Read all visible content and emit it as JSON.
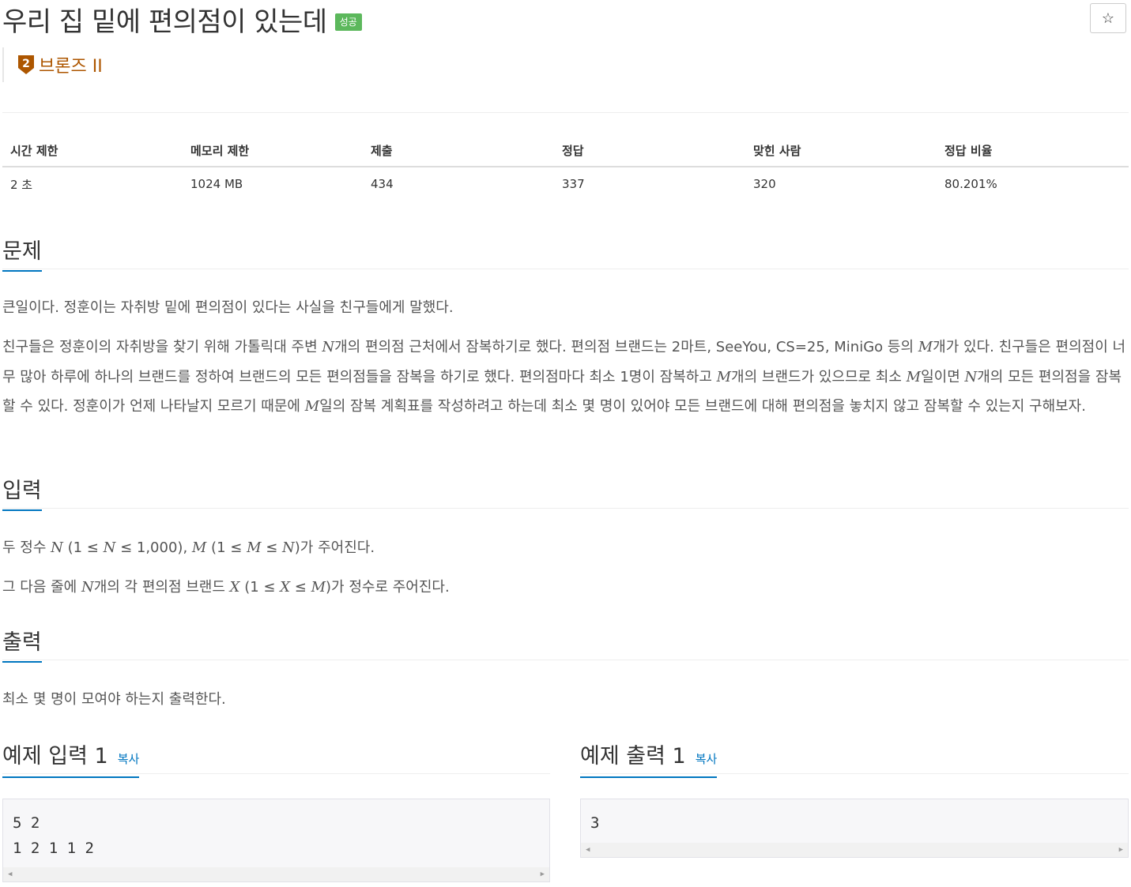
{
  "problem": {
    "title": "우리 집 밑에 편의점이 있는데",
    "status_badge": "성공",
    "tier": {
      "number": "2",
      "label": "브론즈 II",
      "color": "#ad5600"
    }
  },
  "stats": {
    "headers": [
      "시간 제한",
      "메모리 제한",
      "제출",
      "정답",
      "맞힌 사람",
      "정답 비율"
    ],
    "values": [
      "2 초",
      "1024 MB",
      "434",
      "337",
      "320",
      "80.201%"
    ]
  },
  "sections": {
    "problem": {
      "title": "문제",
      "p1": "큰일이다. 정훈이는 자취방 밑에 편의점이 있다는 사실을 친구들에게 말했다.",
      "p2": {
        "a": "친구들은 정훈이의 자취방을 찾기 위해 가톨릭대 주변 ",
        "N1": "N",
        "b": "개의 편의점 근처에서 잠복하기로 했다. 편의점 브랜드는 2마트, SeeYou, CS=25, MiniGo 등의 ",
        "M1": "M",
        "c": "개가 있다. 친구들은 편의점이 너무 많아 하루에 하나의 브랜드를 정하여 브랜드의 모든 편의점들을 잠복을 하기로 했다. 편의점마다 최소 1명이 잠복하고 ",
        "M2": "M",
        "d": "개의 브랜드가 있으므로 최소 ",
        "M3": "M",
        "e": "일이면 ",
        "N2": "N",
        "f": "개의 모든 편의점을 잠복할 수 있다. 정훈이가 언제 나타날지 모르기 때문에 ",
        "M4": "M",
        "g": "일의 잠복 계획표를 작성하려고 하는데 최소 몇 명이 있어야 모든 브랜드에 대해 편의점을 놓치지 않고 잠복할 수 있는지 구해보자."
      }
    },
    "input": {
      "title": "입력",
      "p1": {
        "a": "두 정수 ",
        "N1": "N",
        "b": " (1 ≤ ",
        "N2": "N",
        "c": " ≤ 1,000), ",
        "M1": "M",
        "d": " (1 ≤ ",
        "M2": "M",
        "e": " ≤ ",
        "N3": "N",
        "f": ")가 주어진다."
      },
      "p2": {
        "a": "그 다음 줄에 ",
        "N1": "N",
        "b": "개의 각 편의점 브랜드 ",
        "X1": "X",
        "c": " (1 ≤ ",
        "X2": "X",
        "d": " ≤ ",
        "M1": "M",
        "e": ")가 정수로 주어진다."
      }
    },
    "output": {
      "title": "출력",
      "p1": "최소 몇 명이 모여야 하는지 출력한다."
    }
  },
  "samples": {
    "input": {
      "title": "예제 입력 1",
      "copy": "복사",
      "lines": "5 2\n1 2 1 1 2"
    },
    "output": {
      "title": "예제 출력 1",
      "copy": "복사",
      "lines": "3"
    }
  },
  "icons": {
    "star": "☆"
  }
}
